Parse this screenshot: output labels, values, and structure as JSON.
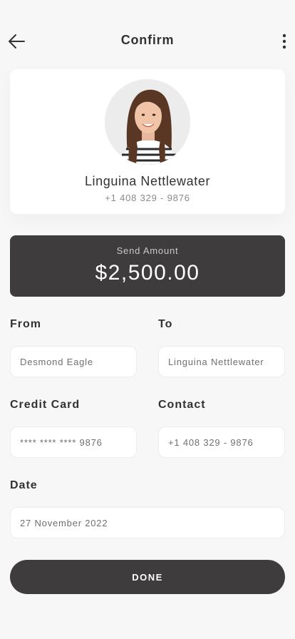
{
  "header": {
    "title": "Confirm",
    "back_icon": "arrow-left-icon",
    "more_icon": "more-vertical-icon"
  },
  "recipient": {
    "name": "Linguina Nettlewater",
    "phone": "+1 408 329 - 9876"
  },
  "amount": {
    "label": "Send Amount",
    "value": "$2,500.00"
  },
  "fields": {
    "from": {
      "label": "From",
      "value": "Desmond Eagle"
    },
    "to": {
      "label": "To",
      "value": "Linguina Nettlewater"
    },
    "credit_card": {
      "label": "Credit Card",
      "value": "**** **** **** 9876"
    },
    "contact": {
      "label": "Contact",
      "value": "+1 408 329 - 9876"
    },
    "date": {
      "label": "Date",
      "value": "27 November 2022"
    }
  },
  "done_label": "DONE",
  "colors": {
    "background": "#f7f7f8",
    "dark": "#3e3c3c",
    "card": "#ffffff",
    "text": "#333233",
    "muted": "#8a8a8a"
  }
}
